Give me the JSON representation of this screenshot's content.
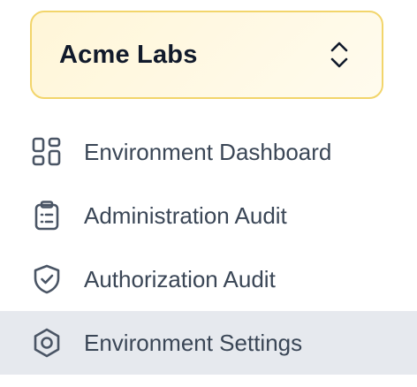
{
  "org_switcher": {
    "name": "Acme Labs",
    "icon": "chevron-up-down-icon"
  },
  "nav": {
    "items": [
      {
        "label": "Environment Dashboard",
        "icon": "dashboard-grid-icon",
        "active": false
      },
      {
        "label": "Administration Audit",
        "icon": "clipboard-list-icon",
        "active": false
      },
      {
        "label": "Authorization Audit",
        "icon": "shield-check-icon",
        "active": false
      },
      {
        "label": "Environment Settings",
        "icon": "settings-hexagon-icon",
        "active": true
      }
    ]
  },
  "colors": {
    "switcher_border": "#f2d56b",
    "switcher_bg": "#fff6d8",
    "active_bg": "#e6e9ee",
    "text": "#3a4656",
    "icon": "#4a5565"
  }
}
